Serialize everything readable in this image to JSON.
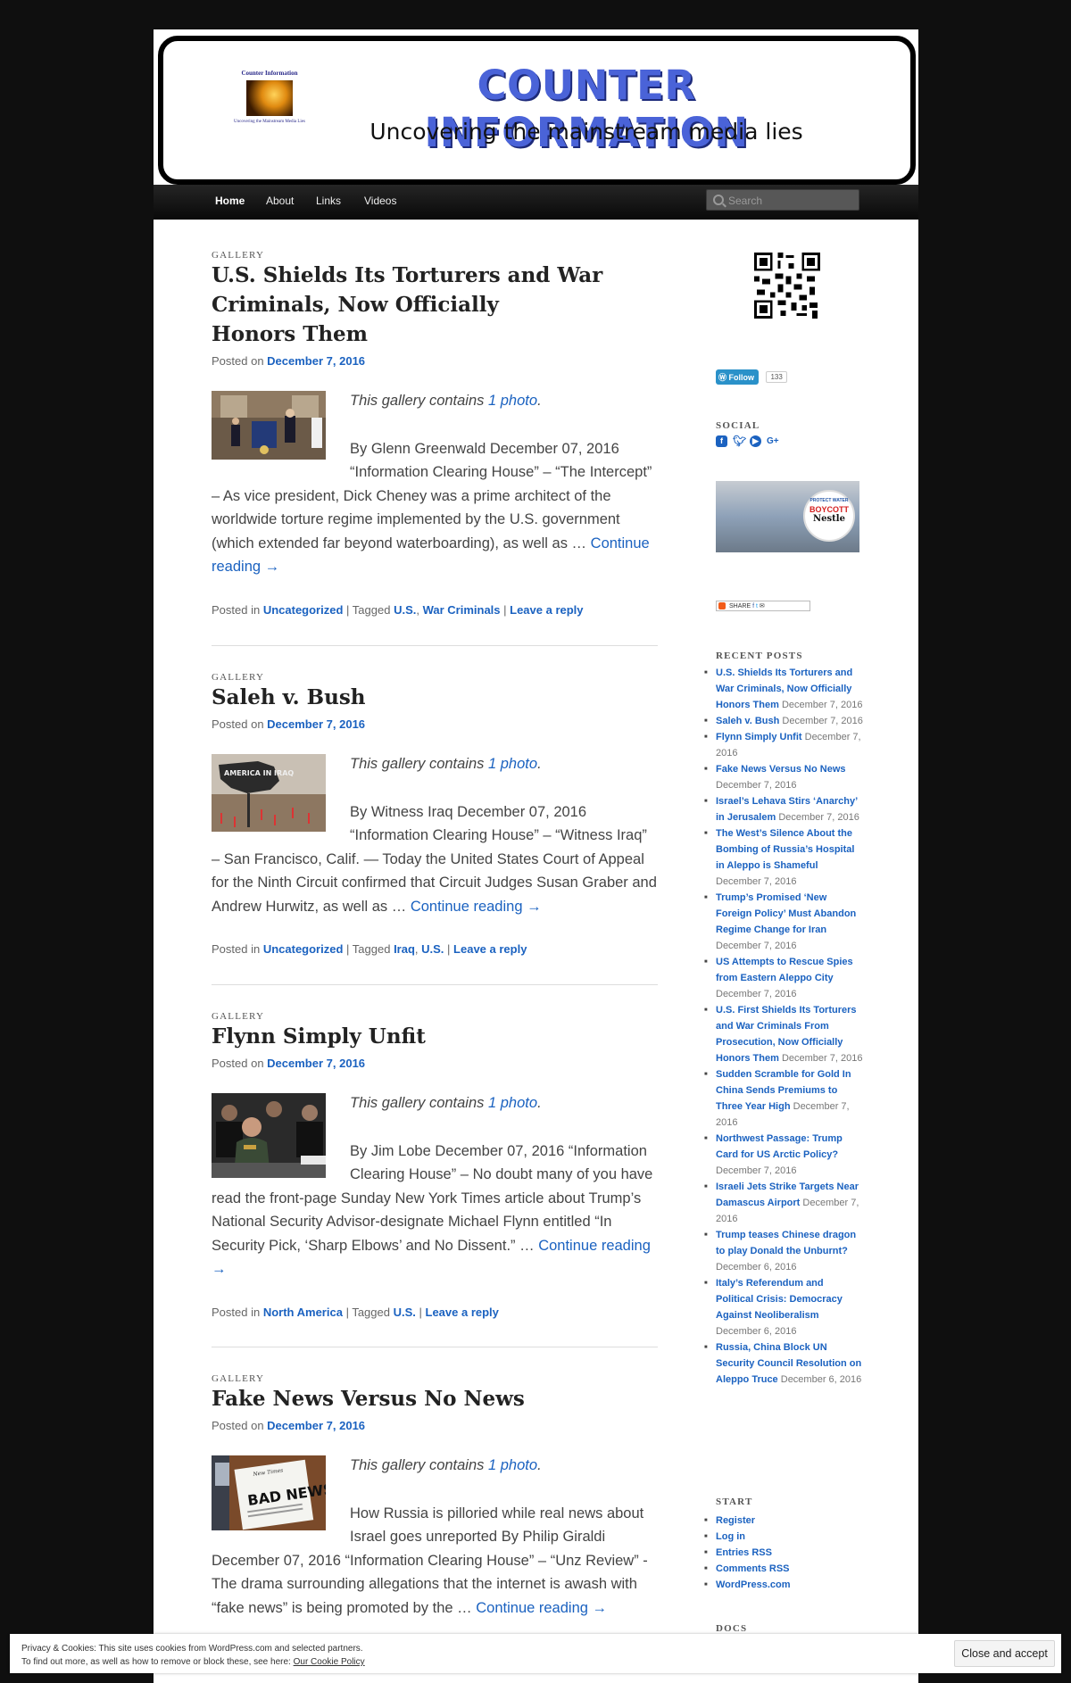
{
  "site": {
    "title": "COUNTER INFORMATION",
    "description": "Uncovering the mainstream media lies",
    "logo_top": "Counter Information",
    "logo_bottom": "Uncovering the Mainstream Media Lies"
  },
  "nav": {
    "items": [
      "Home",
      "About",
      "Links",
      "Videos"
    ],
    "active": "Home",
    "search_placeholder": "Search"
  },
  "posts": [
    {
      "format": "GALLERY",
      "title_lines": [
        "U.S. Shields Its Torturers and War",
        "Criminals, Now Officially",
        "Honors Them"
      ],
      "posted_prefix": "Posted on",
      "date": "December 7, 2016",
      "gallery_prefix": "This gallery contains",
      "gallery_link": "1 photo",
      "gallery_suffix": ".",
      "excerpt": "By Glenn Greenwald December 07, 2016 “Information Clearing House” – “The Intercept” – As vice president, Dick Cheney was a prime architect of the worldwide torture regime implemented by the U.S. government (which extended far beyond waterboarding), as well as …",
      "continue": "Continue reading →",
      "meta_posted_in": "Posted in",
      "category": "Uncategorized",
      "meta_tagged": "| Tagged",
      "tags": [
        "U.S.",
        "War Criminals"
      ],
      "reply": "Leave a reply"
    },
    {
      "format": "GALLERY",
      "title_lines": [
        "Saleh v. Bush"
      ],
      "posted_prefix": "Posted on",
      "date": "December 7, 2016",
      "gallery_prefix": "This gallery contains",
      "gallery_link": "1 photo",
      "gallery_suffix": ".",
      "excerpt": "By Witness Iraq December 07, 2016 “Information Clearing House” – “Witness Iraq” – San Francisco, Calif. — Today the United States Court of Appeal for the Ninth Circuit confirmed that Circuit Judges Susan Graber and Andrew Hurwitz, as well as …",
      "continue": "Continue reading →",
      "meta_posted_in": "Posted in",
      "category": "Uncategorized",
      "meta_tagged": "| Tagged",
      "tags": [
        "Iraq",
        "U.S."
      ],
      "reply": "Leave a reply",
      "image_text": "AMERICA IN IRAQ"
    },
    {
      "format": "GALLERY",
      "title_lines": [
        "Flynn Simply Unfit"
      ],
      "posted_prefix": "Posted on",
      "date": "December 7, 2016",
      "gallery_prefix": "This gallery contains",
      "gallery_link": "1 photo",
      "gallery_suffix": ".",
      "excerpt": "By Jim Lobe December 07, 2016 “Information Clearing House” – No doubt many of you have read the front-page Sunday New York Times article about Trump’s National Security Advisor-designate Michael Flynn entitled “In Security Pick, ‘Sharp Elbows’ and No Dissent.” …",
      "continue": "Continue reading →",
      "meta_posted_in": "Posted in",
      "category": "North America",
      "meta_tagged": "| Tagged",
      "tags": [
        "U.S."
      ],
      "reply": "Leave a reply"
    },
    {
      "format": "GALLERY",
      "title_lines": [
        "Fake News Versus No News"
      ],
      "posted_prefix": "Posted on",
      "date": "December 7, 2016",
      "gallery_prefix": "This gallery contains",
      "gallery_link": "1 photo",
      "gallery_suffix": ".",
      "excerpt": "How Russia is pilloried while real news about Israel goes unreported By Philip Giraldi December 07, 2016 “Information Clearing House” – “Unz Review” - The drama surrounding allegations that the internet is awash with “fake news” is being promoted by the …",
      "continue": "Continue reading →",
      "image_text": "BAD NEWS!",
      "image_header": "New Times"
    }
  ],
  "sidebar": {
    "follow_label": "Follow",
    "follow_count": "133",
    "social_title": "SOCIAL",
    "social_icons": [
      "facebook-icon",
      "twitter-icon",
      "youtube-icon",
      "google-plus-icon"
    ],
    "boycott_lines": [
      "PROTECT WATER",
      "BOYCOTT",
      "Nestle"
    ],
    "share_label": "SHARE",
    "recent_title": "RECENT POSTS",
    "recent": [
      {
        "title": "U.S. Shields Its Torturers and War Criminals, Now Officially Honors Them",
        "date": "December 7, 2016"
      },
      {
        "title": "Saleh v. Bush",
        "date": "December 7, 2016"
      },
      {
        "title": "Flynn Simply Unfit",
        "date": "December 7, 2016"
      },
      {
        "title": "Fake News Versus No News",
        "date": "December 7, 2016"
      },
      {
        "title": "Israel’s Lehava Stirs ‘Anarchy’ in Jerusalem",
        "date": "December 7, 2016"
      },
      {
        "title": "The West’s Silence About the Bombing of Russia’s Hospital in Aleppo is Shameful",
        "date": "December 7, 2016"
      },
      {
        "title": "Trump’s Promised ‘New Foreign Policy’ Must Abandon Regime Change for Iran",
        "date": "December 7, 2016"
      },
      {
        "title": "US Attempts to Rescue Spies from Eastern Aleppo City",
        "date": "December 7, 2016"
      },
      {
        "title": "U.S. First Shields Its Torturers and War Criminals From Prosecution, Now Officially Honors Them",
        "date": "December 7, 2016"
      },
      {
        "title": "Sudden Scramble for Gold In China Sends Premiums to Three Year High",
        "date": "December 7, 2016"
      },
      {
        "title": "Northwest Passage: Trump Card for US Arctic Policy?",
        "date": "December 7, 2016"
      },
      {
        "title": "Israeli Jets Strike Targets Near Damascus Airport",
        "date": "December 7, 2016"
      },
      {
        "title": "Trump teases Chinese dragon to play Donald the Unburnt?",
        "date": "December 6, 2016"
      },
      {
        "title": "Italy’s Referendum and Political Crisis: Democracy Against Neoliberalism",
        "date": "December 6, 2016"
      },
      {
        "title": "Russia, China Block UN Security Council Resolution on Aleppo Truce",
        "date": "December 6, 2016"
      }
    ],
    "start_title": "START",
    "start_links": [
      "Register",
      "Log in",
      "Entries RSS",
      "Comments RSS",
      "WordPress.com"
    ],
    "docs_title": "DOCS"
  },
  "cookie": {
    "line1": "Privacy & Cookies: This site uses cookies from WordPress.com and selected partners.",
    "line2_prefix": "To find out more, as well as how to remove or block these, see here:",
    "line2_link": "Our Cookie Policy",
    "button": "Close and accept"
  }
}
